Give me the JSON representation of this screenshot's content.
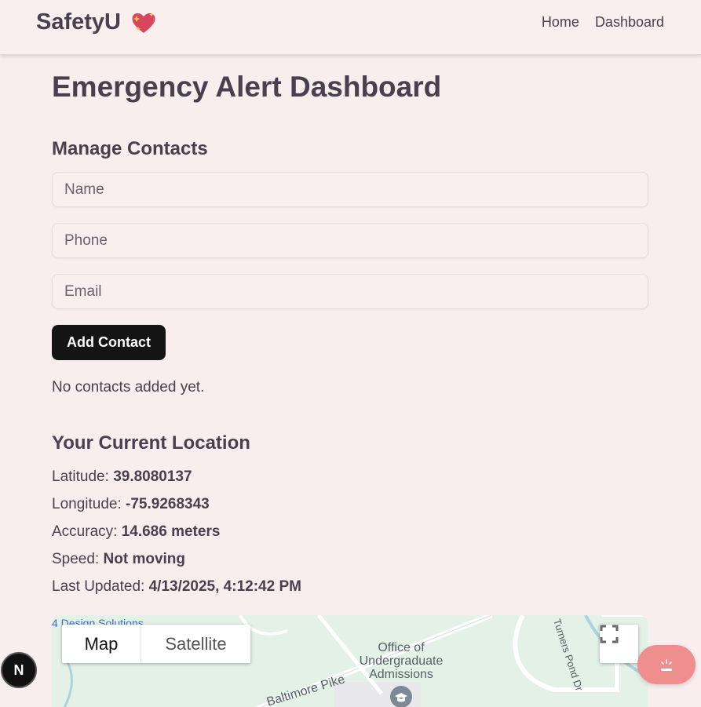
{
  "navbar": {
    "brand": "SafetyU",
    "brand_icon": "sparkling-heart-icon",
    "links": [
      "Home",
      "Dashboard"
    ]
  },
  "page": {
    "title": "Emergency Alert Dashboard"
  },
  "contacts": {
    "section_title": "Manage Contacts",
    "name_placeholder": "Name",
    "phone_placeholder": "Phone",
    "email_placeholder": "Email",
    "add_button": "Add Contact",
    "empty_message": "No contacts added yet."
  },
  "location": {
    "section_title": "Your Current Location",
    "latitude_label": "Latitude:",
    "latitude_value": "39.8080137",
    "longitude_label": "Longitude:",
    "longitude_value": "-75.9268343",
    "accuracy_label": "Accuracy:",
    "accuracy_value": "14.686 meters",
    "speed_label": "Speed:",
    "speed_value": "Not moving",
    "updated_label": "Last Updated:",
    "updated_value": "4/13/2025, 4:12:42 PM"
  },
  "map": {
    "type_map": "Map",
    "type_satellite": "Satellite",
    "poi_label": "4 Design Solutions",
    "place_label": "Office of Undergraduate Admissions",
    "road_baltimore": "Baltimore Pike",
    "road_turners": "Turners Pond Dr",
    "colors": {
      "land": "#e4f1e6",
      "road": "#ffffff",
      "water": "#aad3df"
    }
  },
  "overlays": {
    "dev_badge": "N",
    "fab_icon": "alert-light-icon",
    "fab_color": "#ee8e8e"
  }
}
